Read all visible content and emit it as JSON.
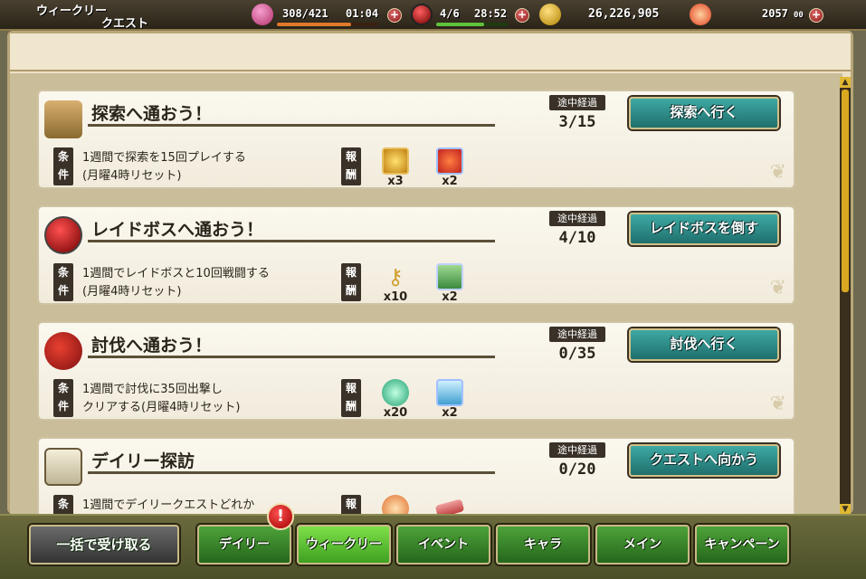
{
  "header": {
    "title_line1": "ウィークリー",
    "title_line2": "クエスト",
    "stamina": "308/421",
    "stamina_timer": "01:04",
    "bp": "4/6",
    "bp_timer": "28:52",
    "gold": "26,226,905",
    "gems": "2057",
    "gems_small": "00"
  },
  "quests": [
    {
      "title": "探索へ通おう！",
      "progress_label": "途中経過",
      "progress": "3/15",
      "button": "探索へ行く",
      "condition_tag": "条件",
      "condition_line1": "1週間で探索を15回プレイする",
      "condition_line2": "(月曜4時リセット)",
      "reward_tag": "報酬",
      "rewards": [
        {
          "icon": "gold-coin-icon",
          "count": "x3"
        },
        {
          "icon": "red-gem-card-icon",
          "count": "x2"
        }
      ]
    },
    {
      "title": "レイドボスへ通おう！",
      "progress_label": "途中経過",
      "progress": "4/10",
      "button": "レイドボスを倒す",
      "condition_tag": "条件",
      "condition_line1": "1週間でレイドボスと10回戦闘する",
      "condition_line2": "(月曜4時リセット)",
      "reward_tag": "報酬",
      "rewards": [
        {
          "icon": "key-icon",
          "count": "x10"
        },
        {
          "icon": "green-card-icon",
          "count": "x2"
        }
      ]
    },
    {
      "title": "討伐へ通おう！",
      "progress_label": "途中経過",
      "progress": "0/35",
      "button": "討伐へ行く",
      "condition_tag": "条件",
      "condition_line1": "1週間で討伐に35回出撃し",
      "condition_line2": "クリアする(月曜4時リセット)",
      "reward_tag": "報酬",
      "rewards": [
        {
          "icon": "green-gear-icon",
          "count": "x20"
        },
        {
          "icon": "blue-card-icon",
          "count": "x2"
        }
      ]
    },
    {
      "title": "デイリー探訪",
      "progress_label": "途中経過",
      "progress": "0/20",
      "button": "クエストへ向かう",
      "condition_tag": "条件",
      "condition_line1": "1週間でデイリークエストどれか",
      "condition_line2": "",
      "reward_tag": "報酬",
      "rewards": [
        {
          "icon": "flower-medal-icon",
          "count": ""
        },
        {
          "icon": "ticket-icon",
          "count": ""
        }
      ]
    }
  ],
  "nav": {
    "collect_all": "一括で受け取る",
    "daily": "デイリー",
    "weekly": "ウィークリー",
    "event": "イベント",
    "chara": "キャラ",
    "main": "メイン",
    "campaign": "キャンペーン",
    "alert": "!"
  },
  "colors": {
    "go_button": "#2a8a86",
    "nav_green": "#3a8a2a",
    "nav_active": "#5fc83a",
    "panel_bg": "#ece1c6"
  }
}
